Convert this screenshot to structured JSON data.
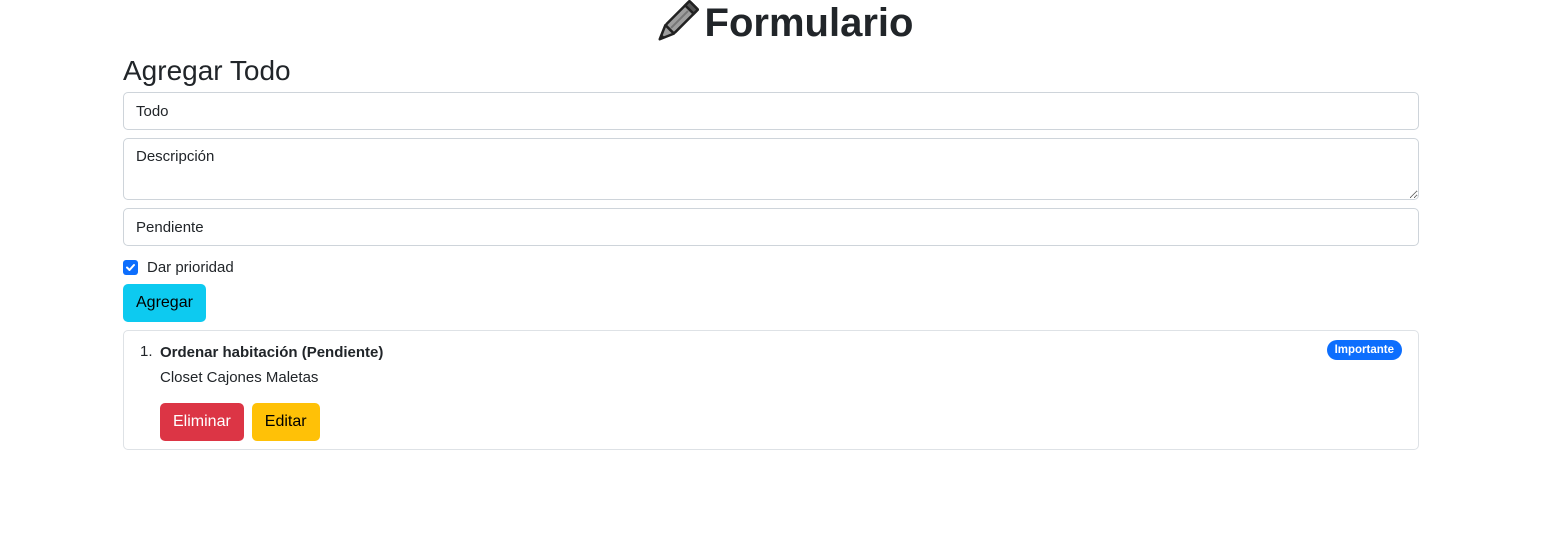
{
  "header": {
    "title": "Formulario",
    "icon": "pencil-icon"
  },
  "form": {
    "heading": "Agregar Todo",
    "todo_placeholder": "Todo",
    "description_placeholder": "Descripción",
    "status_value": "Pendiente",
    "priority_label": "Dar prioridad",
    "priority_checked": true,
    "submit_label": "Agregar"
  },
  "todos": [
    {
      "number": "1.",
      "title": "Ordenar habitación (Pendiente)",
      "description": "Closet Cajones Maletas",
      "badge": "Importante",
      "delete_label": "Eliminar",
      "edit_label": "Editar"
    }
  ],
  "colors": {
    "primary": "#0d6efd",
    "info": "#0dcaf0",
    "danger": "#dc3545",
    "warning": "#ffc107"
  }
}
